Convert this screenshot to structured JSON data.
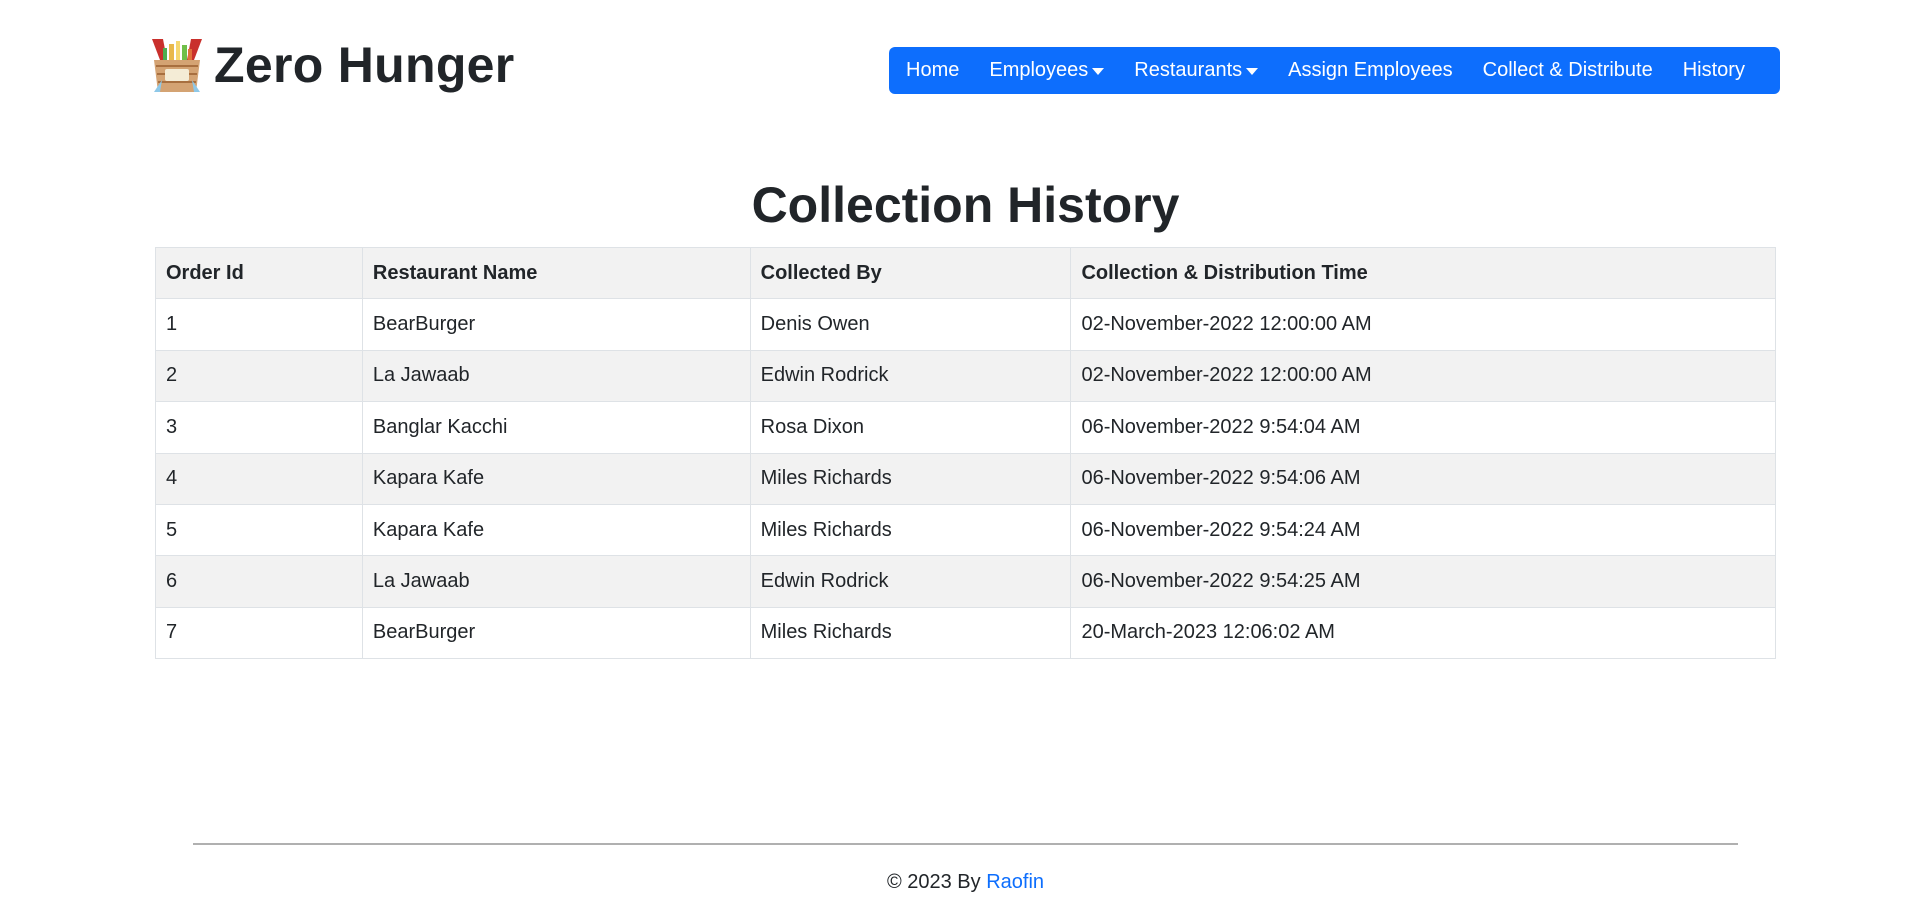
{
  "brand": {
    "title": "Zero Hunger",
    "logo_icon": "food-basket-icon"
  },
  "nav": {
    "items": [
      {
        "label": "Home",
        "has_dropdown": false
      },
      {
        "label": "Employees",
        "has_dropdown": true
      },
      {
        "label": "Restaurants",
        "has_dropdown": true
      },
      {
        "label": "Assign Employees",
        "has_dropdown": false
      },
      {
        "label": "Collect & Distribute",
        "has_dropdown": false
      },
      {
        "label": "History",
        "has_dropdown": false
      }
    ],
    "background": "#0d6efd"
  },
  "main": {
    "title": "Collection History",
    "table": {
      "headers": [
        "Order Id",
        "Restaurant Name",
        "Collected By",
        "Collection & Distribution Time"
      ],
      "rows": [
        [
          "1",
          "BearBurger",
          "Denis Owen",
          "02-November-2022 12:00:00 AM"
        ],
        [
          "2",
          "La Jawaab",
          "Edwin Rodrick",
          "02-November-2022 12:00:00 AM"
        ],
        [
          "3",
          "Banglar Kacchi",
          "Rosa Dixon",
          "06-November-2022 9:54:04 AM"
        ],
        [
          "4",
          "Kapara Kafe",
          "Miles Richards",
          "06-November-2022 9:54:06 AM"
        ],
        [
          "5",
          "Kapara Kafe",
          "Miles Richards",
          "06-November-2022 9:54:24 AM"
        ],
        [
          "6",
          "La Jawaab",
          "Edwin Rodrick",
          "06-November-2022 9:54:25 AM"
        ],
        [
          "7",
          "BearBurger",
          "Miles Richards",
          "20-March-2023 12:06:02 AM"
        ]
      ]
    }
  },
  "footer": {
    "copyright": "© 2023 By ",
    "author": "Raofin",
    "link_color": "#0d6efd"
  }
}
